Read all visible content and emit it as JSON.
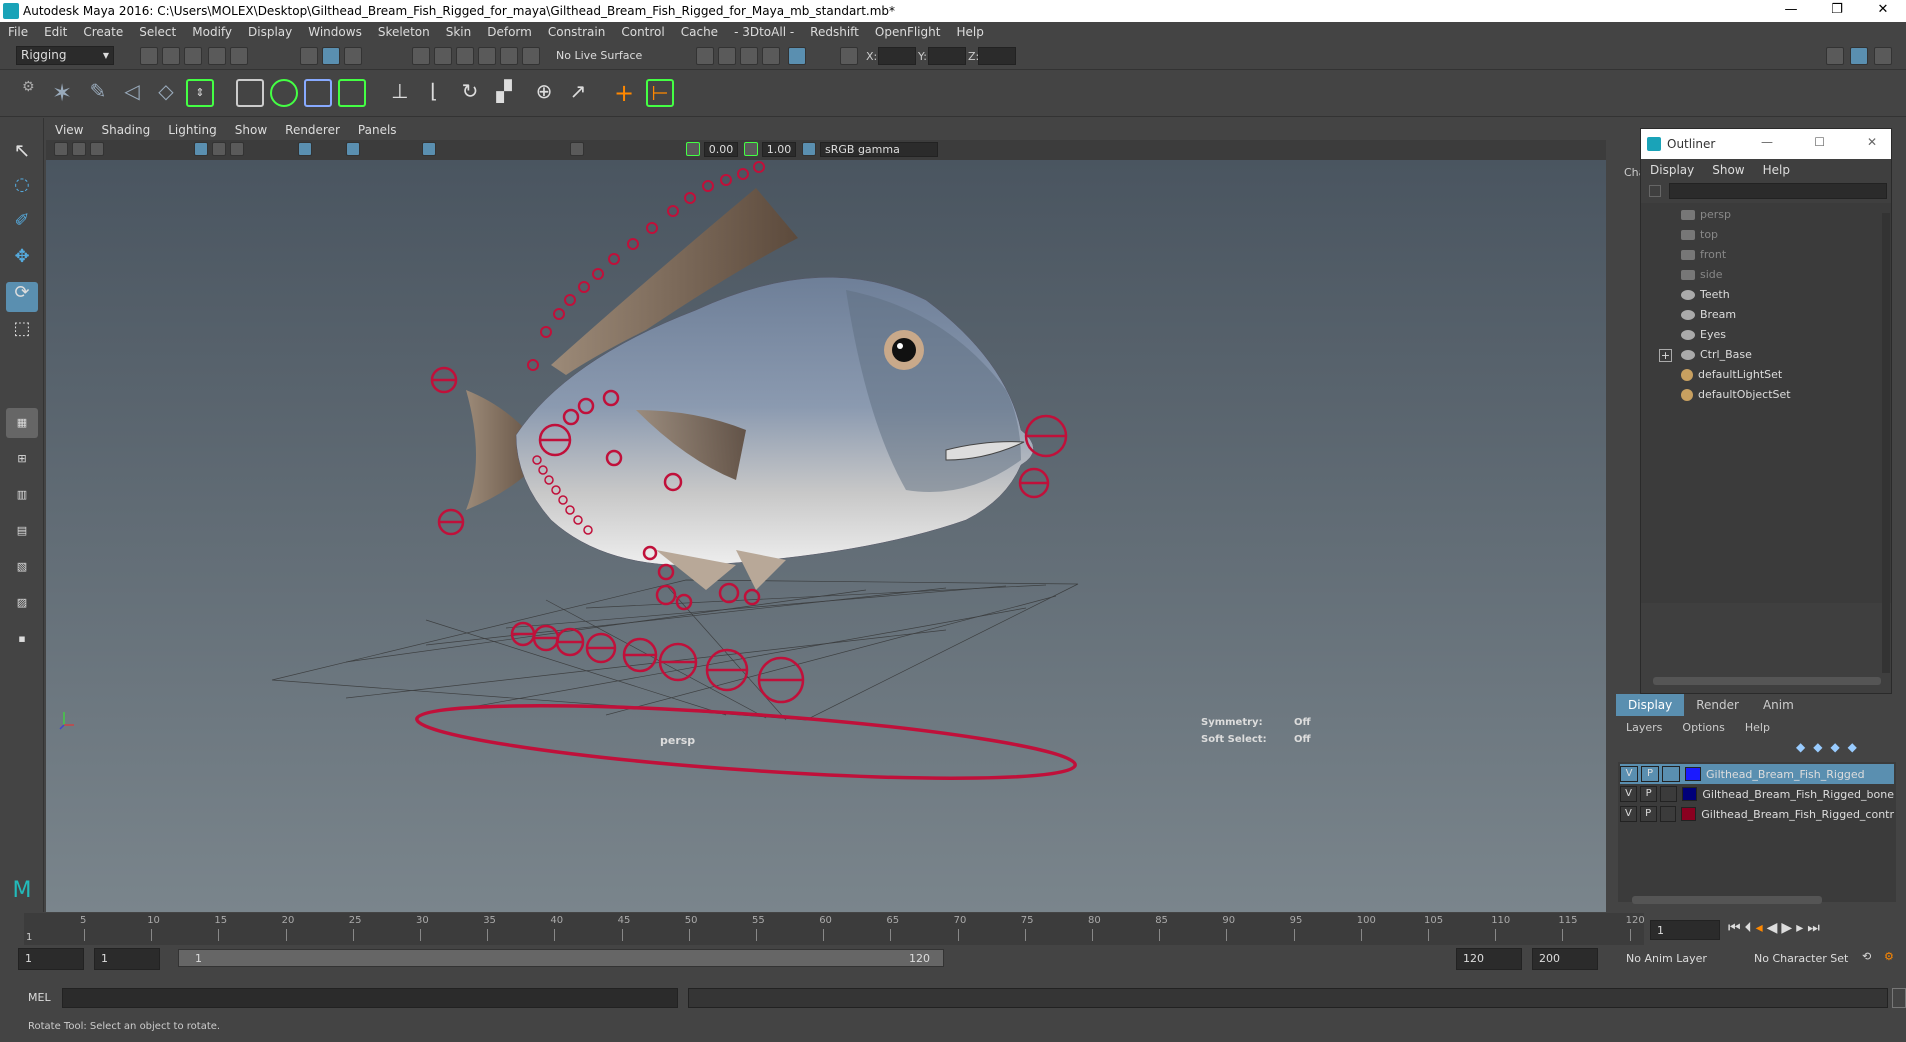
{
  "window": {
    "title": "Autodesk Maya 2016: C:\\Users\\MOLEX\\Desktop\\Gilthead_Bream_Fish_Rigged_for_maya\\Gilthead_Bream_Fish_Rigged_for_Maya_mb_standart.mb*",
    "minimize": "—",
    "restore": "❐",
    "close": "✕"
  },
  "menubar": [
    "File",
    "Edit",
    "Create",
    "Select",
    "Modify",
    "Display",
    "Windows",
    "Skeleton",
    "Skin",
    "Deform",
    "Constrain",
    "Control",
    "Cache",
    "- 3DtoAll -",
    "Redshift",
    "OpenFlight",
    "Help"
  ],
  "statusline": {
    "mode": "Rigging",
    "live_surface": "No Live Surface",
    "x_label": "X:",
    "y_label": "Y:",
    "z_label": "Z:"
  },
  "viewport": {
    "menu": [
      "View",
      "Shading",
      "Lighting",
      "Show",
      "Renderer",
      "Panels"
    ],
    "field_a": "0.00",
    "field_b": "1.00",
    "color_space": "sRGB gamma",
    "camera": "persp",
    "symmetry_label": "Symmetry:",
    "symmetry_value": "Off",
    "soft_select_label": "Soft Select:",
    "soft_select_value": "Off"
  },
  "outliner": {
    "title": "Outliner",
    "menu": [
      "Display",
      "Show",
      "Help"
    ],
    "side_label": "Cha",
    "items": [
      {
        "label": "persp",
        "icon": "camera-icon",
        "dim": true
      },
      {
        "label": "top",
        "icon": "camera-icon",
        "dim": true
      },
      {
        "label": "front",
        "icon": "camera-icon",
        "dim": true
      },
      {
        "label": "side",
        "icon": "camera-icon",
        "dim": true
      },
      {
        "label": "Teeth",
        "icon": "mesh-icon",
        "dim": false
      },
      {
        "label": "Bream",
        "icon": "mesh-icon",
        "dim": false
      },
      {
        "label": "Eyes",
        "icon": "mesh-icon",
        "dim": false
      },
      {
        "label": "Ctrl_Base",
        "icon": "curve-icon",
        "dim": false
      },
      {
        "label": "defaultLightSet",
        "icon": "set-icon",
        "dim": false
      },
      {
        "label": "defaultObjectSet",
        "icon": "set-icon",
        "dim": false
      }
    ],
    "expand_glyph": "+"
  },
  "layers": {
    "tabs": [
      "Display",
      "Render",
      "Anim"
    ],
    "menu": [
      "Layers",
      "Options",
      "Help"
    ],
    "rows": [
      {
        "v": "V",
        "p": "P",
        "color": "#1a1aff",
        "name": "Gilthead_Bream_Fish_Rigged",
        "selected": true
      },
      {
        "v": "V",
        "p": "P",
        "color": "#00007a",
        "name": "Gilthead_Bream_Fish_Rigged_bone",
        "selected": false
      },
      {
        "v": "V",
        "p": "P",
        "color": "#8a0020",
        "name": "Gilthead_Bream_Fish_Rigged_contr",
        "selected": false
      }
    ]
  },
  "timeline": {
    "ticks": [
      "5",
      "10",
      "15",
      "20",
      "25",
      "30",
      "35",
      "40",
      "45",
      "50",
      "55",
      "60",
      "65",
      "70",
      "75",
      "80",
      "85",
      "90",
      "95",
      "100",
      "105",
      "110",
      "115",
      "120"
    ],
    "start_marker": "1",
    "current_frame": "1"
  },
  "range": {
    "start": "1",
    "playback_start": "1",
    "slider_start": "1",
    "slider_end": "120",
    "playback_end": "120",
    "end": "200",
    "anim_layer": "No Anim Layer",
    "character_set": "No Character Set"
  },
  "cmd": {
    "label": "MEL"
  },
  "help": {
    "text": "Rotate Tool: Select an object to rotate."
  },
  "colors": {
    "accent": "#5a8fb0",
    "controls": "#c0103a",
    "joints": "#1a2a80"
  }
}
